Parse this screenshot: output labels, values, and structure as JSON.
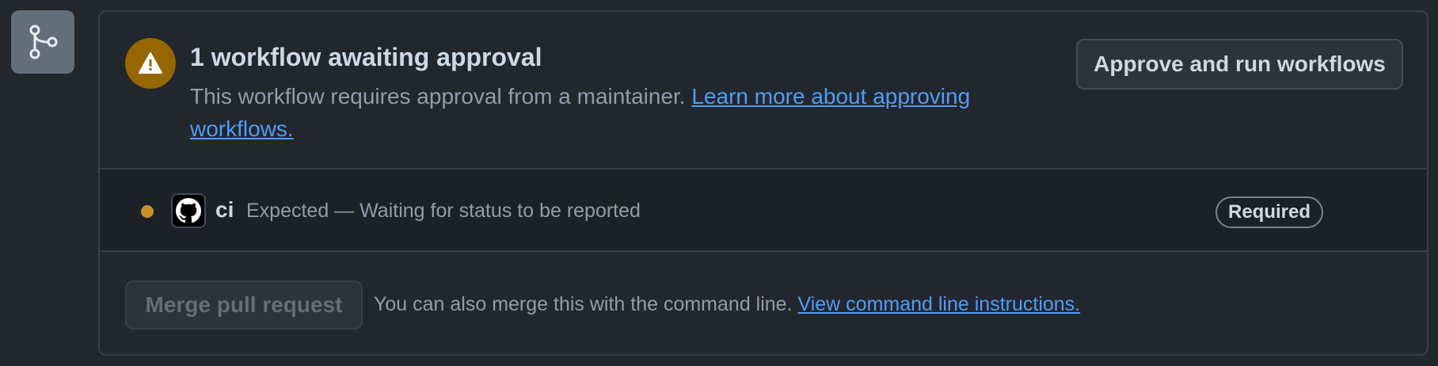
{
  "approval": {
    "title": "1 workflow awaiting approval",
    "description": "This workflow requires approval from a maintainer. ",
    "learn_more_link": "Learn more about approving workflows.",
    "approve_button": "Approve and run workflows",
    "warning_icon": "alert-icon"
  },
  "check": {
    "name": "ci",
    "status": "Expected — Waiting for status to be reported",
    "badge": "Required",
    "avatar_icon": "github-mark-icon",
    "status_dot_color": "#c69026"
  },
  "merge": {
    "button": "Merge pull request",
    "text": "You can also merge this with the command line. ",
    "instructions_link": "View command line instructions."
  },
  "colors": {
    "background": "#22272e",
    "accent_link": "#539bf5",
    "warning": "#966600"
  }
}
